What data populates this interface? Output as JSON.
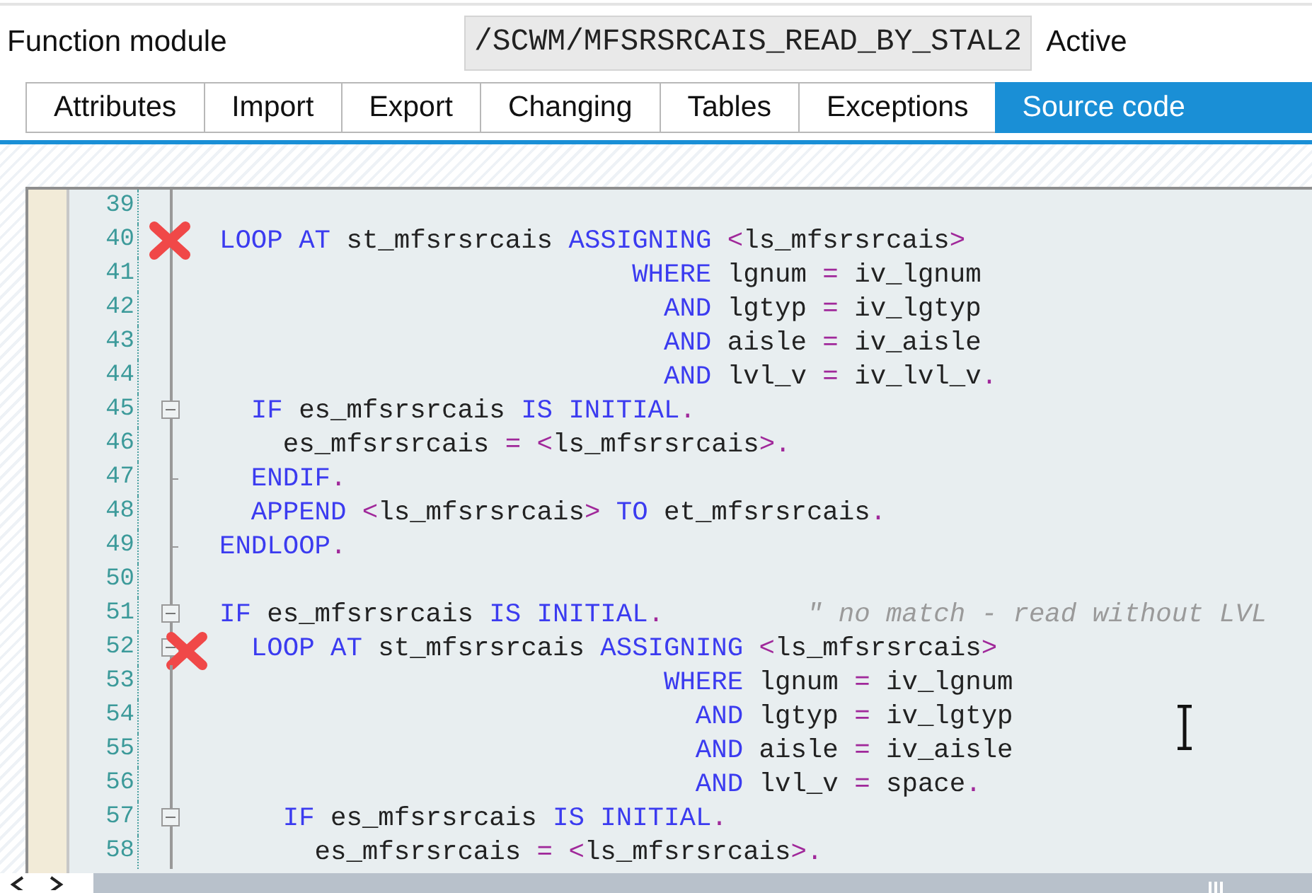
{
  "header": {
    "label": "Function module",
    "name": "/SCWM/MFSRSRCAIS_READ_BY_STAL2",
    "status": "Active"
  },
  "tabs": [
    {
      "label": "Attributes",
      "selected": false
    },
    {
      "label": "Import",
      "selected": false
    },
    {
      "label": "Export",
      "selected": false
    },
    {
      "label": "Changing",
      "selected": false
    },
    {
      "label": "Tables",
      "selected": false
    },
    {
      "label": "Exceptions",
      "selected": false
    },
    {
      "label": "Source code",
      "selected": true
    }
  ],
  "lines": [
    {
      "number": "39",
      "breakpoint": false,
      "kind": "plain"
    },
    {
      "number": "40",
      "breakpoint": true,
      "kind": "plain",
      "code": [
        {
          "kind": "keyword",
          "text": "LOOP AT"
        },
        {
          "kind": "ident",
          "text": " st_mfsrsrcais "
        },
        {
          "kind": "keyword",
          "text": "ASSIGNING"
        },
        {
          "kind": "op",
          "text": " <"
        },
        {
          "kind": "ident",
          "text": "ls_mfsrsrcais"
        },
        {
          "kind": "op",
          "text": ">"
        }
      ]
    },
    {
      "number": "41",
      "breakpoint": false,
      "kind": "plain",
      "code": [
        {
          "kind": "keyword",
          "text": "                          WHERE"
        },
        {
          "kind": "ident",
          "text": " lgnum "
        },
        {
          "kind": "op",
          "text": "="
        },
        {
          "kind": "ident",
          "text": " iv_lgnum"
        }
      ]
    },
    {
      "number": "42",
      "breakpoint": false,
      "kind": "plain",
      "code": [
        {
          "kind": "keyword",
          "text": "                            AND"
        },
        {
          "kind": "ident",
          "text": " lgtyp "
        },
        {
          "kind": "op",
          "text": "="
        },
        {
          "kind": "ident",
          "text": " iv_lgtyp"
        }
      ]
    },
    {
      "number": "43",
      "breakpoint": false,
      "kind": "plain",
      "code": [
        {
          "kind": "keyword",
          "text": "                            AND"
        },
        {
          "kind": "ident",
          "text": " aisle "
        },
        {
          "kind": "op",
          "text": "="
        },
        {
          "kind": "ident",
          "text": " iv_aisle"
        }
      ]
    },
    {
      "number": "44",
      "breakpoint": false,
      "kind": "plain",
      "code": [
        {
          "kind": "keyword",
          "text": "                            AND"
        },
        {
          "kind": "ident",
          "text": " lvl_v "
        },
        {
          "kind": "op",
          "text": "="
        },
        {
          "kind": "ident",
          "text": " iv_lvl_v"
        },
        {
          "kind": "op",
          "text": "."
        }
      ]
    },
    {
      "number": "45",
      "breakpoint": false,
      "kind": "open",
      "code": [
        {
          "kind": "keyword",
          "text": "  IF"
        },
        {
          "kind": "ident",
          "text": " es_mfsrsrcais "
        },
        {
          "kind": "keyword",
          "text": "IS INITIAL"
        },
        {
          "kind": "op",
          "text": "."
        }
      ]
    },
    {
      "number": "46",
      "breakpoint": false,
      "kind": "plain",
      "code": [
        {
          "kind": "ident",
          "text": "    es_mfsrsrcais "
        },
        {
          "kind": "op",
          "text": "= <"
        },
        {
          "kind": "ident",
          "text": "ls_mfsrsrcais"
        },
        {
          "kind": "op",
          "text": ">."
        }
      ]
    },
    {
      "number": "47",
      "breakpoint": false,
      "kind": "end",
      "code": [
        {
          "kind": "keyword",
          "text": "  ENDIF"
        },
        {
          "kind": "op",
          "text": "."
        }
      ]
    },
    {
      "number": "48",
      "breakpoint": false,
      "kind": "plain",
      "code": [
        {
          "kind": "keyword",
          "text": "  APPEND"
        },
        {
          "kind": "op",
          "text": " <"
        },
        {
          "kind": "ident",
          "text": "ls_mfsrsrcais"
        },
        {
          "kind": "op",
          "text": ">"
        },
        {
          "kind": "keyword",
          "text": " TO"
        },
        {
          "kind": "ident",
          "text": " et_mfsrsrcais"
        },
        {
          "kind": "op",
          "text": "."
        }
      ]
    },
    {
      "number": "49",
      "breakpoint": false,
      "kind": "end",
      "code": [
        {
          "kind": "keyword",
          "text": "ENDLOOP"
        },
        {
          "kind": "op",
          "text": "."
        }
      ]
    },
    {
      "number": "50",
      "breakpoint": false,
      "kind": "plain"
    },
    {
      "number": "51",
      "breakpoint": false,
      "kind": "open",
      "code": [
        {
          "kind": "keyword",
          "text": "IF"
        },
        {
          "kind": "ident",
          "text": " es_mfsrsrcais "
        },
        {
          "kind": "keyword",
          "text": "IS INITIAL"
        },
        {
          "kind": "op",
          "text": "."
        },
        {
          "kind": "comment",
          "text": "         \" no match - read without LVL"
        }
      ]
    },
    {
      "number": "52",
      "breakpoint": true,
      "kind": "open",
      "code": [
        {
          "kind": "keyword",
          "text": "  LOOP AT"
        },
        {
          "kind": "ident",
          "text": " st_mfsrsrcais "
        },
        {
          "kind": "keyword",
          "text": "ASSIGNING"
        },
        {
          "kind": "op",
          "text": " <"
        },
        {
          "kind": "ident",
          "text": "ls_mfsrsrcais"
        },
        {
          "kind": "op",
          "text": ">"
        }
      ]
    },
    {
      "number": "53",
      "breakpoint": false,
      "kind": "plain",
      "code": [
        {
          "kind": "keyword",
          "text": "                            WHERE"
        },
        {
          "kind": "ident",
          "text": " lgnum "
        },
        {
          "kind": "op",
          "text": "="
        },
        {
          "kind": "ident",
          "text": " iv_lgnum"
        }
      ]
    },
    {
      "number": "54",
      "breakpoint": false,
      "kind": "plain",
      "code": [
        {
          "kind": "keyword",
          "text": "                              AND"
        },
        {
          "kind": "ident",
          "text": " lgtyp "
        },
        {
          "kind": "op",
          "text": "="
        },
        {
          "kind": "ident",
          "text": " iv_lgtyp"
        }
      ]
    },
    {
      "number": "55",
      "breakpoint": false,
      "kind": "plain",
      "code": [
        {
          "kind": "keyword",
          "text": "                              AND"
        },
        {
          "kind": "ident",
          "text": " aisle "
        },
        {
          "kind": "op",
          "text": "="
        },
        {
          "kind": "ident",
          "text": " iv_aisle"
        }
      ]
    },
    {
      "number": "56",
      "breakpoint": false,
      "kind": "plain",
      "code": [
        {
          "kind": "keyword",
          "text": "                              AND"
        },
        {
          "kind": "ident",
          "text": " lvl_v "
        },
        {
          "kind": "op",
          "text": "="
        },
        {
          "kind": "ident",
          "text": " space"
        },
        {
          "kind": "op",
          "text": "."
        }
      ]
    },
    {
      "number": "57",
      "breakpoint": false,
      "kind": "open",
      "code": [
        {
          "kind": "keyword",
          "text": "    IF"
        },
        {
          "kind": "ident",
          "text": " es_mfsrsrcais "
        },
        {
          "kind": "keyword",
          "text": "IS INITIAL"
        },
        {
          "kind": "op",
          "text": "."
        }
      ]
    },
    {
      "number": "58",
      "breakpoint": false,
      "kind": "plain",
      "code": [
        {
          "kind": "ident",
          "text": "      es_mfsrsrcais "
        },
        {
          "kind": "op",
          "text": "= <"
        },
        {
          "kind": "ident",
          "text": "ls_mfsrsrcais"
        },
        {
          "kind": "op",
          "text": ">."
        }
      ]
    }
  ]
}
